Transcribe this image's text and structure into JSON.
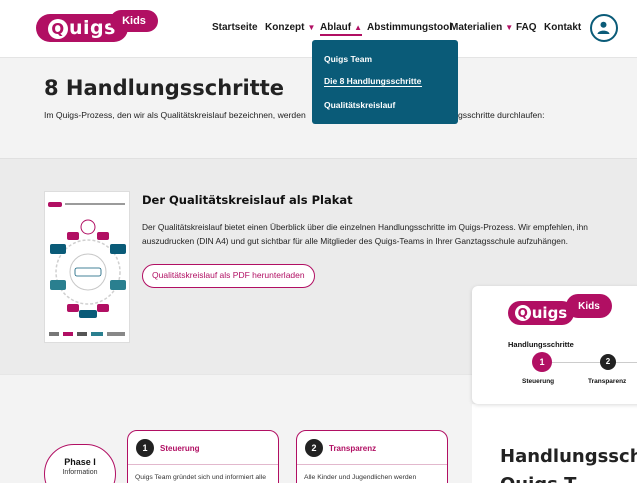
{
  "logo": {
    "wordmark": "Quigs",
    "kids": "Kids"
  },
  "nav": {
    "items": [
      {
        "label": "Startseite",
        "chevron": false
      },
      {
        "label": "Konzept",
        "chevron": "down"
      },
      {
        "label": "Ablauf",
        "chevron": "up",
        "active": true
      },
      {
        "label": "Abstimmungstool",
        "chevron": false
      },
      {
        "label": "Materialien",
        "chevron": "down"
      },
      {
        "label": "FAQ",
        "chevron": false
      },
      {
        "label": "Kontakt",
        "chevron": false
      }
    ],
    "user_icon": "user-circle-icon"
  },
  "dropdown": {
    "items": [
      "Quigs Team",
      "Die 8 Handlungsschritte",
      "Qualitätskreislauf"
    ],
    "active_index": 1
  },
  "page": {
    "title": "8 Handlungsschritte",
    "intro_start": "Im Quigs-Prozess, den wir als Qualitätskreislauf bezeichnen, werden",
    "intro_end": "gsschritte durchlaufen:"
  },
  "poster": {
    "title": "Der Qualitätskreislauf als Plakat",
    "text": "Der Qualitätskreislauf bietet einen Überblick über die einzelnen Handlungsschritte im Quigs-Prozess. Wir empfehlen, ihn auszudrucken (DIN A4) und gut sichtbar für alle Mitglieder des Quigs-Teams in Ihrer Ganztagsschule aufzuhängen.",
    "button": "Qualitätskreislauf als PDF herunterladen"
  },
  "phase": {
    "title": "Phase I",
    "subtitle": "Information"
  },
  "cards": [
    {
      "number": "1",
      "title": "Steuerung",
      "text": "Quigs Team gründet sich und informiert alle"
    },
    {
      "number": "2",
      "title": "Transparenz",
      "text": "Alle Kinder und Jugendlichen werden"
    }
  ],
  "float_panel": {
    "heading": "Handlungsschritte",
    "steps": [
      {
        "number": "1",
        "label": "Steuerung",
        "active": true
      },
      {
        "number": "2",
        "label": "Transparenz",
        "active": false
      }
    ]
  },
  "right_heading": {
    "line1": "Handlungsschr",
    "line2": "Quigs T..."
  },
  "colors": {
    "brand": "#b10f63",
    "dropdown": "#0a5b78",
    "accent_dark": "#222222"
  }
}
